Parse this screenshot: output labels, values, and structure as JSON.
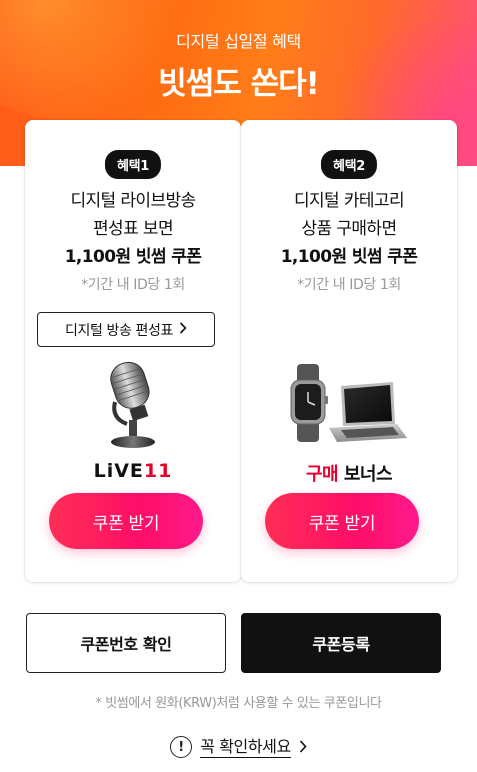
{
  "hero": {
    "subtitle": "디지털 십일절 혜택",
    "title": "빗썸도 쏜다!"
  },
  "cards": [
    {
      "badge": "혜택1",
      "line1": "디지털 라이브방송",
      "line2": "편성표 보면",
      "line3": "1,100원 빗썸 쿠폰",
      "note": "*기간 내 ID당 1회",
      "schedule_button": "디지털 방송 편성표",
      "brand_prefix": "LiVE",
      "brand_suffix": "11",
      "coupon_button": "쿠폰 받기"
    },
    {
      "badge": "혜택2",
      "line1": "디지털 카테고리",
      "line2": "상품 구매하면",
      "line3": "1,100원 빗썸 쿠폰",
      "note": "*기간 내 ID당 1회",
      "brand_red": "구매",
      "brand_black": "보너스",
      "coupon_button": "쿠폰 받기"
    }
  ],
  "buttons": {
    "check_coupon": "쿠폰번호 확인",
    "register_coupon": "쿠폰등록"
  },
  "disclaimer": "* 빗썸에서 원화(KRW)처럼 사용할 수 있는 쿠폰입니다",
  "must_check": "꼭 확인하세요",
  "colors": {
    "accent": "#ff0d68",
    "hero_orange": "#ff6d12",
    "brand_red": "#e8002d"
  },
  "icons": [
    "chevron-right-icon",
    "microphone-icon",
    "smartwatch-icon",
    "laptop-icon",
    "alert-circle-icon"
  ]
}
